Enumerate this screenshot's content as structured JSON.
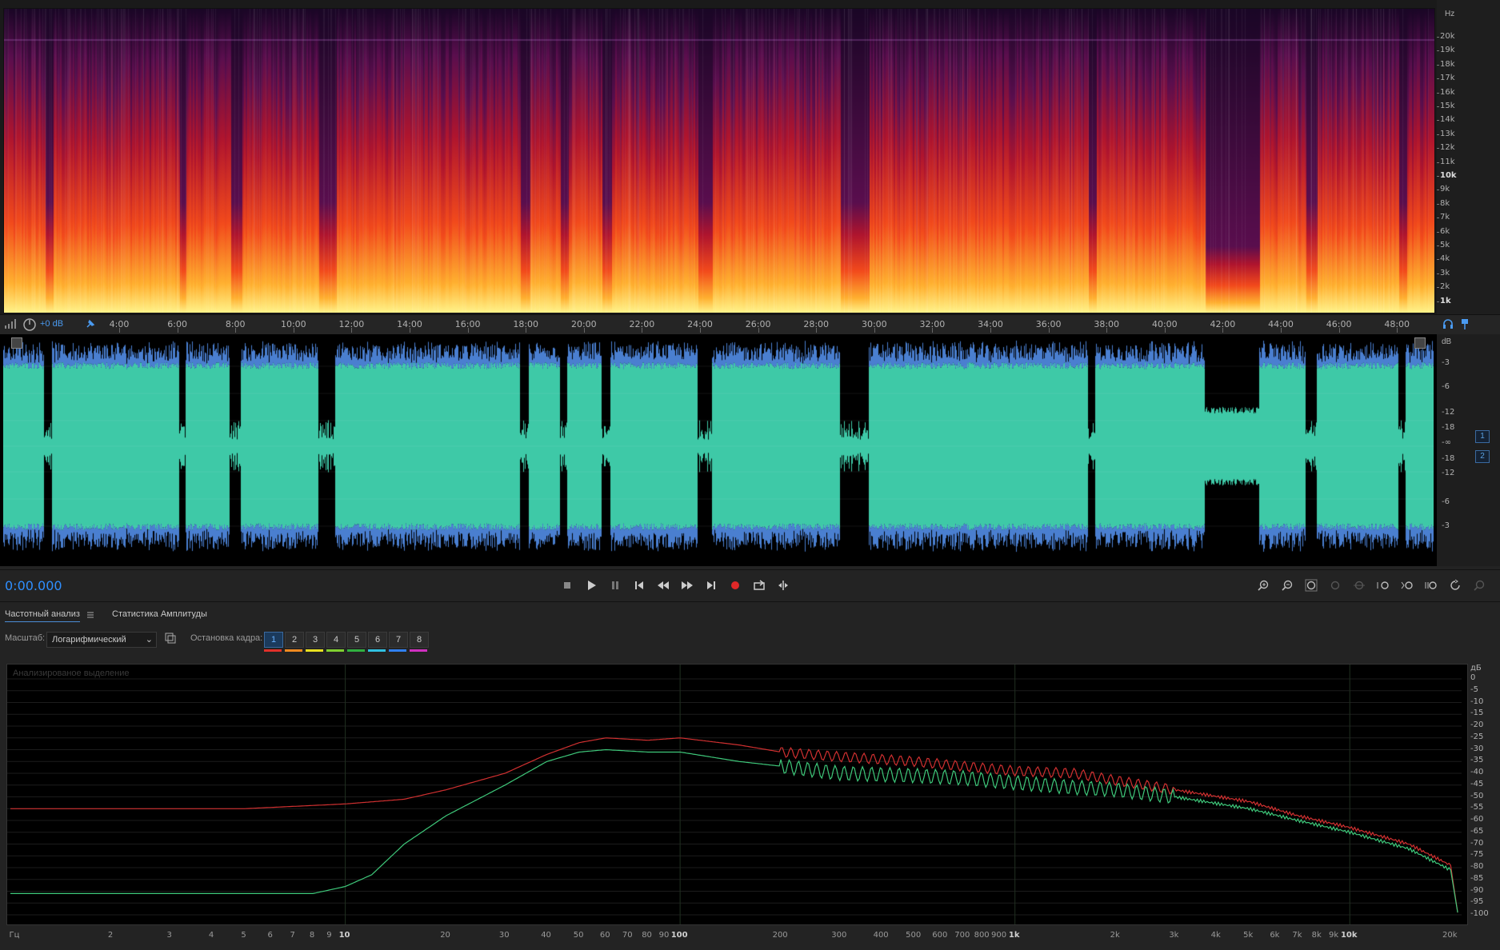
{
  "spectral": {
    "hz_unit": "Hz",
    "hz_ticks": [
      "20k",
      "19k",
      "18k",
      "17k",
      "16k",
      "15k",
      "14k",
      "13k",
      "12k",
      "11k",
      "10k",
      "9k",
      "8k",
      "7k",
      "6k",
      "5k",
      "4k",
      "3k",
      "2k",
      "1k"
    ]
  },
  "timeline": {
    "gain_label": "+0 dB",
    "ticks": [
      "4:00",
      "6:00",
      "8:00",
      "10:00",
      "12:00",
      "14:00",
      "16:00",
      "18:00",
      "20:00",
      "22:00",
      "24:00",
      "26:00",
      "28:00",
      "30:00",
      "32:00",
      "34:00",
      "36:00",
      "38:00",
      "40:00",
      "42:00",
      "44:00",
      "46:00",
      "48:00"
    ]
  },
  "waveform": {
    "db_unit": "dB",
    "db_ticks": [
      "-3",
      "-6",
      "-12",
      "-18",
      "-∞",
      "-18",
      "-12",
      "-6",
      "-3"
    ],
    "channels": [
      "1",
      "2"
    ],
    "colors": {
      "wave": "#3ec9a7",
      "peaks": "#4a7fd0",
      "background": "#000000"
    }
  },
  "transport": {
    "time": "0:00.000",
    "buttons": [
      "stop-icon",
      "play-icon",
      "pause-icon",
      "go-to-start-icon",
      "rewind-icon",
      "fast-forward-icon",
      "go-to-end-icon",
      "record-icon",
      "loop-icon",
      "skip-selection-icon"
    ],
    "zoom_buttons": [
      "zoom-in-amplitude-icon",
      "zoom-out-amplitude-icon",
      "zoom-in-time-icon",
      "zoom-out-time-icon",
      "zoom-full-icon",
      "zoom-selection-icon",
      "zoom-in-left-icon",
      "zoom-in-right-icon",
      "zoom-out-full-icon",
      "zoom-reset-icon"
    ]
  },
  "panel": {
    "tabs": [
      "Частотный анализ",
      "Статистика Амплитуды"
    ],
    "scale_label": "Масштаб:",
    "scale_value": "Логарифмический",
    "frame_label": "Остановка кадра:",
    "frames": [
      "1",
      "2",
      "3",
      "4",
      "5",
      "6",
      "7",
      "8"
    ],
    "frame_colors": [
      "#e0302a",
      "#f08a20",
      "#e8e020",
      "#80d030",
      "#30b040",
      "#30c0e0",
      "#3080f0",
      "#d030c0"
    ],
    "overlay": "Анализированое выделение"
  },
  "chart_data": {
    "type": "line",
    "x_unit": "Гц",
    "xscale": "log",
    "x_ticks": [
      "Гц",
      "2",
      "3",
      "4",
      "5",
      "6",
      "7",
      "8",
      "9",
      "10",
      "20",
      "30",
      "40",
      "50",
      "60",
      "70",
      "80",
      "90",
      "100",
      "200",
      "300",
      "400",
      "500",
      "600",
      "700",
      "800",
      "900",
      "1k",
      "2k",
      "3k",
      "4k",
      "5k",
      "6k",
      "7k",
      "8k",
      "9k",
      "10k",
      "20k"
    ],
    "y_unit": "дБ",
    "y_ticks": [
      "0",
      "-5",
      "-10",
      "-15",
      "-20",
      "-25",
      "-30",
      "-35",
      "-40",
      "-45",
      "-50",
      "-55",
      "-60",
      "-65",
      "-70",
      "-75",
      "-80",
      "-85",
      "-90",
      "-95",
      "-100"
    ],
    "ylim": [
      -100,
      0
    ],
    "xlim": [
      1,
      22050
    ],
    "grid": true,
    "series": [
      {
        "color": "#d03030",
        "x": [
          1,
          5,
          10,
          15,
          20,
          30,
          40,
          50,
          60,
          80,
          100,
          150,
          200,
          300,
          500,
          700,
          1000,
          1500,
          2000,
          3000,
          5000,
          7000,
          10000,
          15000,
          20000,
          21000
        ],
        "y": [
          -55,
          -55,
          -53,
          -51,
          -47,
          -40,
          -32,
          -27,
          -25,
          -26,
          -25,
          -28,
          -31,
          -33,
          -35,
          -37,
          -39,
          -40,
          -43,
          -47,
          -52,
          -58,
          -63,
          -70,
          -79,
          -99
        ]
      },
      {
        "color": "#3ec87a",
        "x": [
          1,
          5,
          8,
          10,
          12,
          15,
          20,
          30,
          40,
          50,
          60,
          80,
          100,
          150,
          200,
          300,
          500,
          700,
          1000,
          1500,
          2000,
          3000,
          5000,
          7000,
          10000,
          15000,
          20000,
          21000
        ],
        "y": [
          -91,
          -91,
          -91,
          -88,
          -83,
          -70,
          -58,
          -45,
          -35,
          -31,
          -30,
          -31,
          -31,
          -35,
          -37,
          -40,
          -41,
          -42,
          -44,
          -46,
          -47,
          -50,
          -55,
          -60,
          -65,
          -72,
          -81,
          -99
        ]
      }
    ]
  }
}
